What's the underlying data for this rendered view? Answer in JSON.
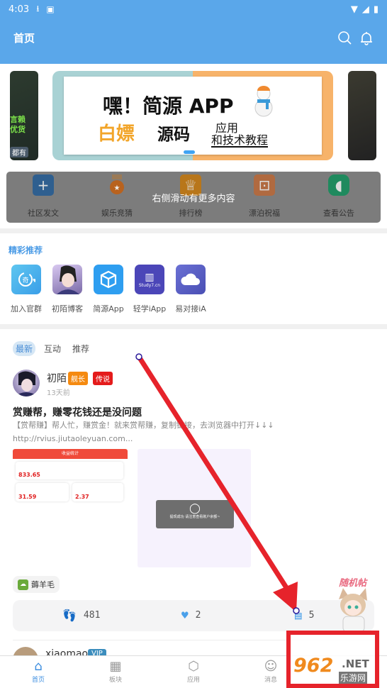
{
  "status_bar": {
    "time": "4:03",
    "icons": [
      "download-icon",
      "a-icon",
      "wifi-icon",
      "signal-icon",
      "battery-icon"
    ]
  },
  "header": {
    "title": "首页",
    "icons": [
      "search-icon",
      "bell-icon"
    ]
  },
  "banner": {
    "left_peek_text": [
      "言赖",
      "优货",
      "都有"
    ],
    "main": {
      "line1": "嘿！简源 APP",
      "line2_orange": "白嫖",
      "line2_black": "源码",
      "line3": "应用",
      "line4": "和技术教程"
    },
    "active_index": 1
  },
  "quick_actions": {
    "overlay_hint": "右侧滑动有更多内容",
    "items": [
      {
        "label": "社区发文",
        "icon": "plus-icon",
        "color": "#2f5f8f"
      },
      {
        "label": "娱乐竞猜",
        "icon": "medal-icon",
        "color": "#b8621e"
      },
      {
        "label": "排行榜",
        "icon": "trophy-icon",
        "color": "#b8761a"
      },
      {
        "label": "漂泊祝福",
        "icon": "gift-icon",
        "color": "#b06a40"
      },
      {
        "label": "查看公告",
        "icon": "speaker-icon",
        "color": "#1f8a5e"
      }
    ]
  },
  "recommend": {
    "title": "精彩推荐",
    "apps": [
      {
        "label": "加入官群",
        "icon": "qi-chat-icon",
        "color": "#4ab0ea"
      },
      {
        "label": "初陌博客",
        "icon": "anime-avatar-icon",
        "color": "#b7a2d8"
      },
      {
        "label": "简源App",
        "icon": "box-icon",
        "color": "#2e9ef0"
      },
      {
        "label": "轻学iApp",
        "icon": "book-icon",
        "color": "#4b46b8",
        "caption": "Study7.cn"
      },
      {
        "label": "易对接iA",
        "icon": "cloud-icon",
        "color": "#5a5fc4"
      }
    ]
  },
  "feed": {
    "tabs": [
      {
        "label": "最新",
        "active": true
      },
      {
        "label": "互动",
        "active": false
      },
      {
        "label": "推荐",
        "active": false
      }
    ],
    "post": {
      "author": "初陌",
      "badges": [
        {
          "label": "舰长",
          "color": "#f58a10"
        },
        {
          "label": "传说",
          "color": "#e41b1b"
        }
      ],
      "time": "13天前",
      "title": "赏赚帮，赚零花钱还是没问题",
      "excerpt": "【赏帮赚】帮人忙，赚赏金！就来赏帮赚，复制链接，去浏览器中打开↓↓↓ http://rvius.jiutaoleyuan.com...",
      "thumb1": {
        "header": "收益统计",
        "values": [
          "833.65",
          "31.59",
          "2.37"
        ]
      },
      "thumb2": {
        "toast": "提现成功 请注意查看账户余额~"
      },
      "tag": "薅羊毛",
      "stats": {
        "views": "481",
        "likes": "2",
        "comments": "5"
      }
    },
    "next_post": {
      "author": "xiaomao",
      "badge": "VIP"
    }
  },
  "floating": {
    "label": "随机帖"
  },
  "watermark": {
    "num": "962",
    "net": ".NET",
    "cn": "乐游网"
  },
  "tabbar": {
    "items": [
      {
        "label": "首页",
        "icon": "home-icon",
        "active": true
      },
      {
        "label": "板块",
        "icon": "grid-icon",
        "active": false
      },
      {
        "label": "应用",
        "icon": "cube-icon",
        "active": false
      },
      {
        "label": "消息",
        "icon": "chat-icon",
        "active": false
      }
    ]
  }
}
